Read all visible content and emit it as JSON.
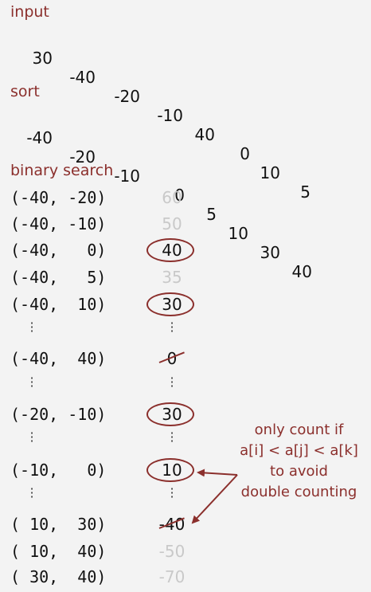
{
  "sections": {
    "input_label": "input",
    "sort_label": "sort",
    "binary_label": "binary search"
  },
  "input_values": [
    "30",
    "-40",
    "-20",
    "-10",
    "40",
    "0",
    "10",
    "5"
  ],
  "sorted_values": [
    "-40",
    "-20",
    "-10",
    "0",
    "5",
    "10",
    "30",
    "40"
  ],
  "search_rows": [
    {
      "pair": "(-40, -20)",
      "value": "60",
      "style": "dim"
    },
    {
      "pair": "(-40, -10)",
      "value": "50",
      "style": "dim"
    },
    {
      "pair": "(-40,   0)",
      "value": "40",
      "style": "circled"
    },
    {
      "pair": "(-40,   5)",
      "value": "35",
      "style": "dim"
    },
    {
      "pair": "(-40,  10)",
      "value": "30",
      "style": "circled"
    },
    {
      "pair": "(-40,  40)",
      "value": "0",
      "style": "struck"
    },
    {
      "pair": "(-20, -10)",
      "value": "30",
      "style": "circled"
    },
    {
      "pair": "(-10,   0)",
      "value": "10",
      "style": "circled"
    },
    {
      "pair": "( 10,  30)",
      "value": "-40",
      "style": "struck"
    },
    {
      "pair": "( 10,  40)",
      "value": "-50",
      "style": "dim"
    },
    {
      "pair": "( 30,  40)",
      "value": "-70",
      "style": "dim"
    }
  ],
  "note": [
    "only count if",
    "a[i] < a[j] < a[k]",
    "to avoid",
    "double counting"
  ],
  "colors": {
    "accent": "#8b2f2c",
    "dim": "#c9c9c9",
    "text": "#111111"
  }
}
